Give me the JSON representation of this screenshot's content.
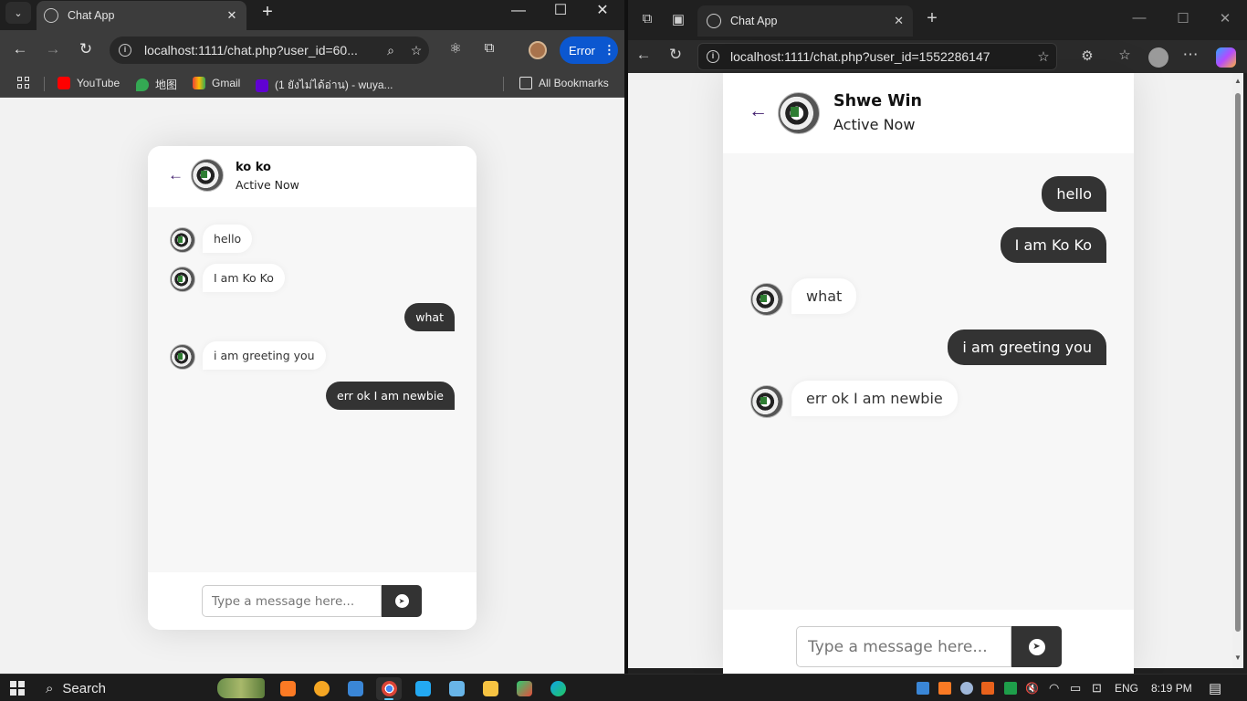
{
  "left_browser": {
    "tab_title": "Chat App",
    "url": "localhost:1111/chat.php?user_id=60...",
    "error_label": "Error",
    "bookmarks": [
      {
        "label": "YouTube"
      },
      {
        "label": "地图"
      },
      {
        "label": "Gmail"
      },
      {
        "label": "(1 ยังไม่ได้อ่าน) - wuya..."
      }
    ],
    "all_bookmarks": "All Bookmarks"
  },
  "left_chat": {
    "user_name": "ko ko",
    "status": "Active Now",
    "messages": [
      {
        "dir": "in",
        "text": "hello"
      },
      {
        "dir": "in",
        "text": "I am Ko Ko"
      },
      {
        "dir": "out",
        "text": "what"
      },
      {
        "dir": "in",
        "text": "i am greeting you"
      },
      {
        "dir": "out",
        "text": "err ok I am newbie"
      }
    ],
    "input_placeholder": "Type a message here..."
  },
  "right_browser": {
    "tab_title": "Chat App",
    "url": "localhost:1111/chat.php?user_id=1552286147"
  },
  "right_chat": {
    "user_name": "Shwe Win",
    "status": "Active Now",
    "messages": [
      {
        "dir": "out",
        "text": "hello"
      },
      {
        "dir": "out",
        "text": "I am Ko Ko"
      },
      {
        "dir": "in",
        "text": "what"
      },
      {
        "dir": "out",
        "text": "i am greeting you"
      },
      {
        "dir": "in",
        "text": "err ok I am newbie"
      }
    ],
    "input_placeholder": "Type a message here..."
  },
  "taskbar": {
    "search_label": "Search",
    "language": "ENG",
    "time": "8:19 PM"
  },
  "colors": {
    "accent_purple": "#3f1b6b",
    "bubble_dark": "#333333",
    "chrome_error_blue": "#0b57d0"
  }
}
